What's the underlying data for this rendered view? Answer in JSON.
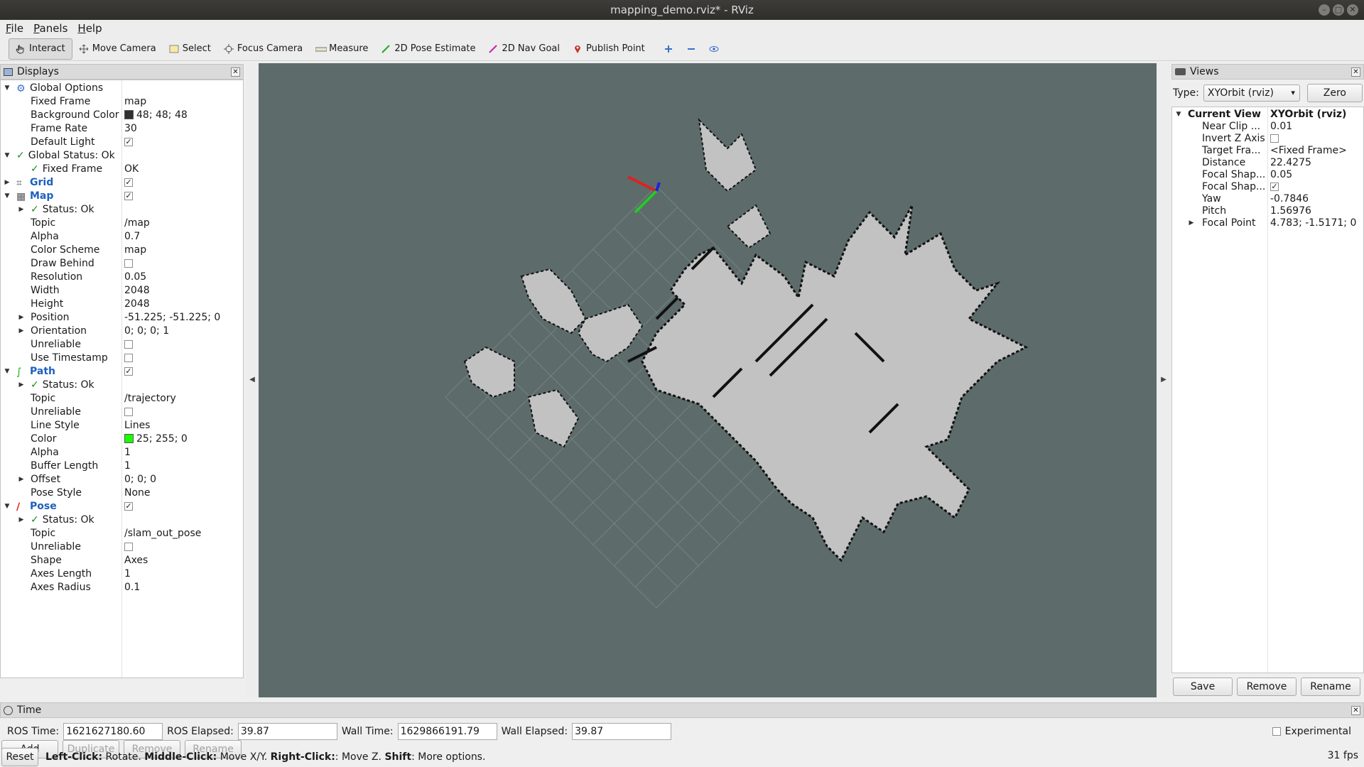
{
  "window": {
    "title": "mapping_demo.rviz* - RViz"
  },
  "menu": {
    "file": "File",
    "panels": "Panels",
    "help": "Help"
  },
  "toolbar": {
    "interact": "Interact",
    "move_camera": "Move Camera",
    "select": "Select",
    "focus_camera": "Focus Camera",
    "measure": "Measure",
    "pose_estimate": "2D Pose Estimate",
    "nav_goal": "2D Nav Goal",
    "publish_point": "Publish Point"
  },
  "displays": {
    "title": "Displays",
    "rows": [
      {
        "label": "Global Options",
        "value": ""
      },
      {
        "label": "Fixed Frame",
        "value": "map"
      },
      {
        "label": "Background Color",
        "value": "48; 48; 48"
      },
      {
        "label": "Frame Rate",
        "value": "30"
      },
      {
        "label": "Default Light",
        "value": ""
      },
      {
        "label": "Global Status: Ok",
        "value": ""
      },
      {
        "label": "Fixed Frame",
        "value": "OK"
      },
      {
        "label": "Grid",
        "value": ""
      },
      {
        "label": "Map",
        "value": ""
      },
      {
        "label": "Status: Ok",
        "value": ""
      },
      {
        "label": "Topic",
        "value": "/map"
      },
      {
        "label": "Alpha",
        "value": "0.7"
      },
      {
        "label": "Color Scheme",
        "value": "map"
      },
      {
        "label": "Draw Behind",
        "value": ""
      },
      {
        "label": "Resolution",
        "value": "0.05"
      },
      {
        "label": "Width",
        "value": "2048"
      },
      {
        "label": "Height",
        "value": "2048"
      },
      {
        "label": "Position",
        "value": "-51.225; -51.225; 0"
      },
      {
        "label": "Orientation",
        "value": "0; 0; 0; 1"
      },
      {
        "label": "Unreliable",
        "value": ""
      },
      {
        "label": "Use Timestamp",
        "value": ""
      },
      {
        "label": "Path",
        "value": ""
      },
      {
        "label": "Status: Ok",
        "value": ""
      },
      {
        "label": "Topic",
        "value": "/trajectory"
      },
      {
        "label": "Unreliable",
        "value": ""
      },
      {
        "label": "Line Style",
        "value": "Lines"
      },
      {
        "label": "Color",
        "value": "25; 255; 0"
      },
      {
        "label": "Alpha",
        "value": "1"
      },
      {
        "label": "Buffer Length",
        "value": "1"
      },
      {
        "label": "Offset",
        "value": "0; 0; 0"
      },
      {
        "label": "Pose Style",
        "value": "None"
      },
      {
        "label": "Pose",
        "value": ""
      },
      {
        "label": "Status: Ok",
        "value": ""
      },
      {
        "label": "Topic",
        "value": "/slam_out_pose"
      },
      {
        "label": "Unreliable",
        "value": ""
      },
      {
        "label": "Shape",
        "value": "Axes"
      },
      {
        "label": "Axes Length",
        "value": "1"
      },
      {
        "label": "Axes Radius",
        "value": "0.1"
      }
    ],
    "buttons": {
      "add": "Add",
      "duplicate": "Duplicate",
      "remove": "Remove",
      "rename": "Rename"
    },
    "colors": {
      "background": "#303030",
      "path": "#19ff00"
    }
  },
  "views": {
    "title": "Views",
    "type_label": "Type:",
    "type_value": "XYOrbit (rviz)",
    "zero": "Zero",
    "current_view": {
      "label": "Current View",
      "value": "XYOrbit (rviz)"
    },
    "rows": [
      {
        "label": "Near Clip ...",
        "value": "0.01"
      },
      {
        "label": "Invert Z Axis",
        "value": ""
      },
      {
        "label": "Target Fra...",
        "value": "<Fixed Frame>"
      },
      {
        "label": "Distance",
        "value": "22.4275"
      },
      {
        "label": "Focal Shap...",
        "value": "0.05"
      },
      {
        "label": "Focal Shap...",
        "value": ""
      },
      {
        "label": "Yaw",
        "value": "-0.7846"
      },
      {
        "label": "Pitch",
        "value": "1.56976"
      },
      {
        "label": "Focal Point",
        "value": "4.783; -1.5171; 0"
      }
    ],
    "buttons": {
      "save": "Save",
      "remove": "Remove",
      "rename": "Rename"
    }
  },
  "time": {
    "title": "Time",
    "ros_time_label": "ROS Time:",
    "ros_time": "1621627180.60",
    "ros_elapsed_label": "ROS Elapsed:",
    "ros_elapsed": "39.87",
    "wall_time_label": "Wall Time:",
    "wall_time": "1629866191.79",
    "wall_elapsed_label": "Wall Elapsed:",
    "wall_elapsed": "39.87",
    "experimental": "Experimental"
  },
  "status": {
    "reset": "Reset",
    "left_click": "Left-Click:",
    "left_desc": "Rotate.",
    "middle_click": "Middle-Click:",
    "middle_desc": "Move X/Y.",
    "right_click": "Right-Click:",
    "right_desc": ": Move Z.",
    "shift": "Shift",
    "shift_desc": ": More options.",
    "fps": "31 fps"
  },
  "viewport": {
    "background": "#5d6b6b",
    "free": "#c2c2c2",
    "wall": "#111111"
  }
}
